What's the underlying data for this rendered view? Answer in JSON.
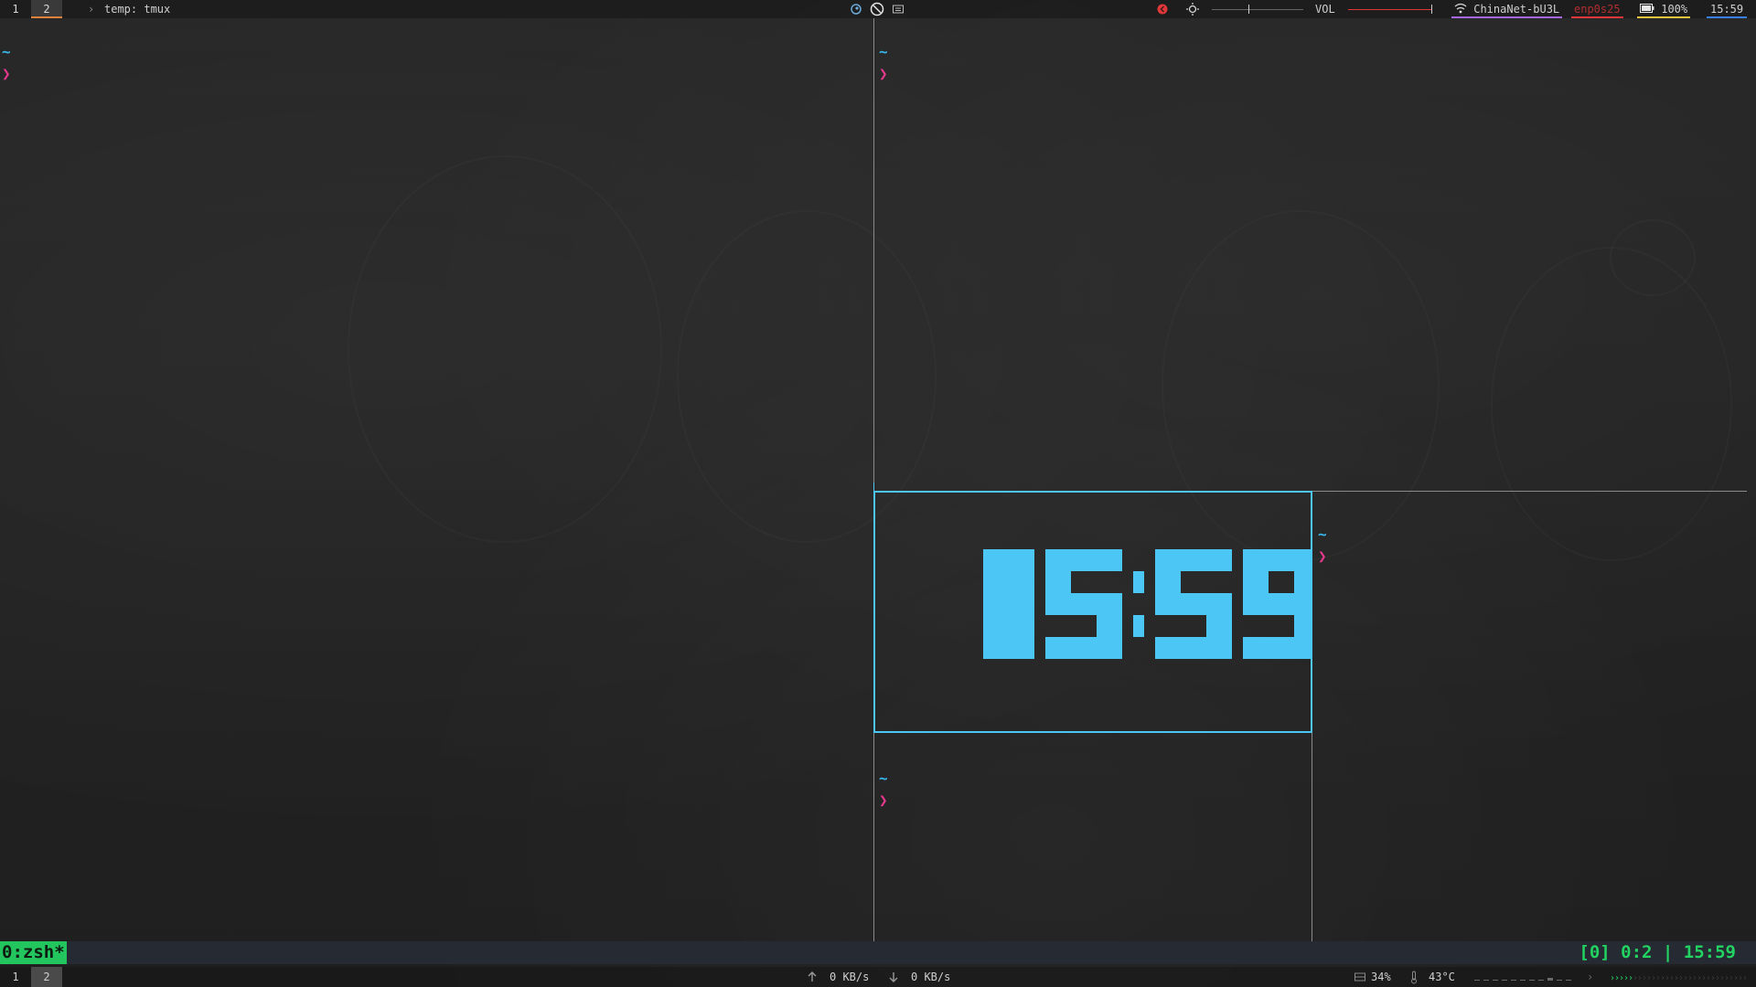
{
  "top_bar": {
    "workspaces": [
      "1",
      "2"
    ],
    "active_workspace": "2",
    "window_title": "temp: tmux",
    "volume_label": "VOL",
    "wifi_name": "ChinaNet-bU3L",
    "ethernet_name": "enp0s25",
    "battery": "100%",
    "clock": "15:59",
    "colors": {
      "active_ws_underline": "#e0813a",
      "wifi_underline": "#a667e6",
      "ethernet_underline": "#e0383a",
      "battery_underline": "#e8c53a",
      "clock_underline": "#3a7ee8"
    },
    "icons": [
      "steam-icon",
      "no-entry-icon",
      "keyboard-icon",
      "record-icon",
      "brightness-icon",
      "wifi-icon",
      "battery-icon"
    ]
  },
  "terminal": {
    "prompt_dir": "~",
    "prompt_symbol": "❯",
    "clock_display": "15:59",
    "colors": {
      "tilde": "#38b9f0",
      "chevron": "#e8398f",
      "active_pane_border": "#4cc6f5",
      "clock_digits": "#4cc6f5"
    }
  },
  "tmux_status": {
    "window": "0:zsh*",
    "right": "[0] 0:2 | 15:59",
    "colors": {
      "window_bg": "#22c55e",
      "right_text": "#22d361"
    }
  },
  "bottom_bar": {
    "workspaces": [
      "1",
      "2"
    ],
    "active_workspace": "2",
    "upload": "0 KB/s",
    "download": "0 KB/s",
    "memory": "34%",
    "temperature": "43°C"
  }
}
